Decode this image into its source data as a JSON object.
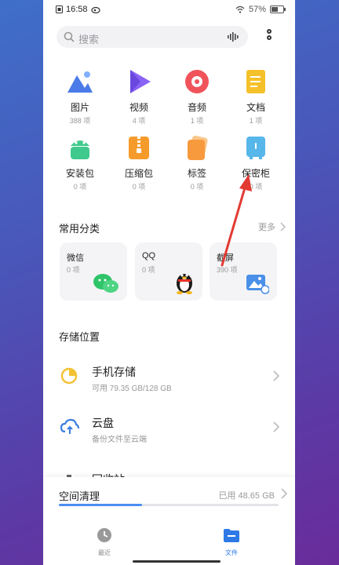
{
  "status": {
    "time": "16:58",
    "battery": "57%"
  },
  "search": {
    "placeholder": "搜索"
  },
  "categories": [
    {
      "label": "图片",
      "count": "388 项",
      "icon": "picture-icon",
      "color": "#4a7be8"
    },
    {
      "label": "视频",
      "count": "4 项",
      "icon": "video-icon",
      "color": "#7a5bf0"
    },
    {
      "label": "音频",
      "count": "1 项",
      "icon": "audio-icon",
      "color": "#f0545a"
    },
    {
      "label": "文档",
      "count": "1 项",
      "icon": "document-icon",
      "color": "#f5c12b"
    },
    {
      "label": "安装包",
      "count": "0 项",
      "icon": "android-icon",
      "color": "#40c98c"
    },
    {
      "label": "压缩包",
      "count": "0 项",
      "icon": "archive-icon",
      "color": "#f59b2b"
    },
    {
      "label": "标签",
      "count": "0 项",
      "icon": "tag-icon",
      "color": "#f79a3d"
    },
    {
      "label": "保密柜",
      "count": "0 项",
      "icon": "safe-icon",
      "color": "#57b6ea"
    }
  ],
  "common": {
    "title": "常用分类",
    "more": "更多",
    "cards": [
      {
        "title": "微信",
        "count": "0 项",
        "icon": "wechat-icon"
      },
      {
        "title": "QQ",
        "count": "0 项",
        "icon": "qq-penguin-icon"
      },
      {
        "title": "截屏",
        "count": "390 项",
        "icon": "screenshot-icon"
      }
    ]
  },
  "storage": {
    "title": "存储位置",
    "items": [
      {
        "name": "手机存储",
        "sub": "可用 79.35 GB/128 GB",
        "icon": "phone-storage-icon"
      },
      {
        "name": "云盘",
        "sub": "备份文件至云端",
        "icon": "cloud-icon"
      },
      {
        "name": "回收站",
        "sub": "",
        "icon": "trash-icon"
      }
    ]
  },
  "clean": {
    "title": "空间清理",
    "used": "已用 48.65 GB",
    "used_fraction": 0.38
  },
  "tabs": [
    {
      "label": "最近",
      "icon": "clock-icon",
      "active": false
    },
    {
      "label": "文件",
      "icon": "folder-icon",
      "active": true
    }
  ],
  "colors": {
    "accent": "#2e79e6",
    "annotation_arrow": "#e23a32"
  }
}
